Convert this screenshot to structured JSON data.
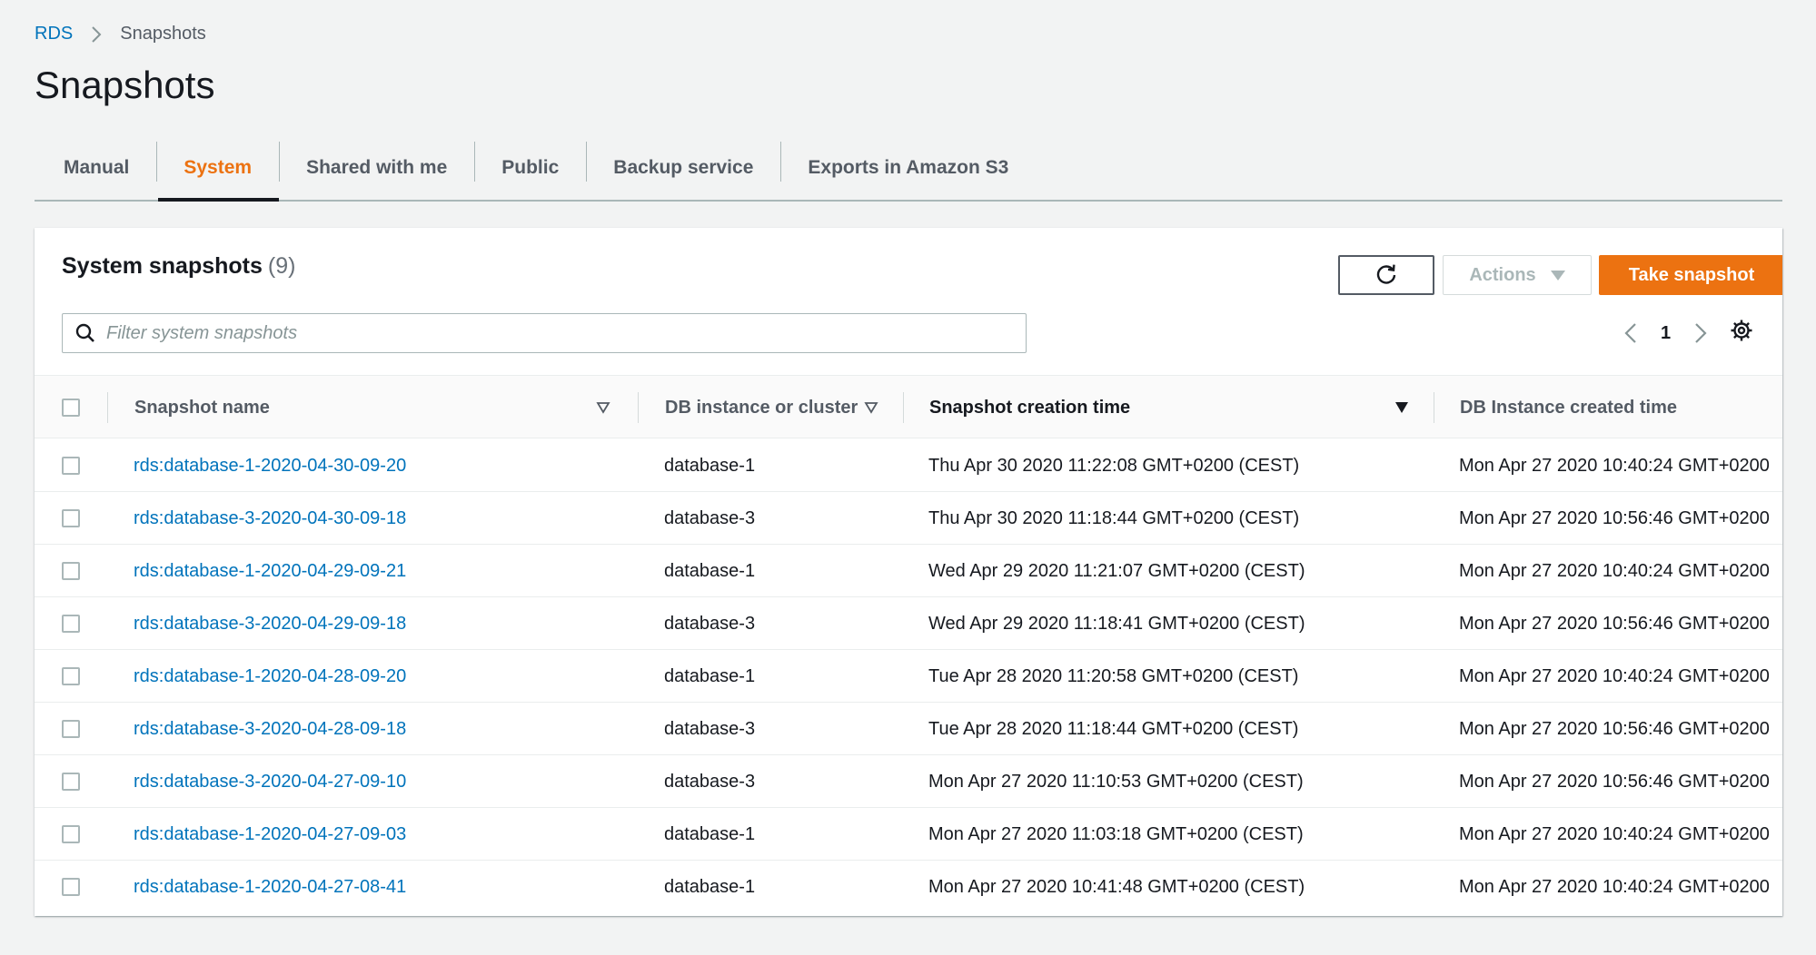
{
  "breadcrumb": {
    "root": "RDS",
    "current": "Snapshots"
  },
  "page": {
    "title": "Snapshots"
  },
  "tabs": [
    {
      "label": "Manual",
      "active": false
    },
    {
      "label": "System",
      "active": true
    },
    {
      "label": "Shared with me",
      "active": false
    },
    {
      "label": "Public",
      "active": false
    },
    {
      "label": "Backup service",
      "active": false
    },
    {
      "label": "Exports in Amazon S3",
      "active": false
    }
  ],
  "panel": {
    "title": "System snapshots",
    "count": "(9)",
    "actions_label": "Actions",
    "primary_label": "Take snapshot",
    "search_placeholder": "Filter system snapshots",
    "search_value": "",
    "current_page": "1"
  },
  "table": {
    "columns": {
      "name": "Snapshot name",
      "db": "DB instance or cluster",
      "created": "Snapshot creation time",
      "instance_created": "DB Instance created time"
    },
    "rows": [
      {
        "name": "rds:database-1-2020-04-30-09-20",
        "db": "database-1",
        "created": "Thu Apr 30 2020 11:22:08 GMT+0200 (CEST)",
        "instance_created": "Mon Apr 27 2020 10:40:24 GMT+0200"
      },
      {
        "name": "rds:database-3-2020-04-30-09-18",
        "db": "database-3",
        "created": "Thu Apr 30 2020 11:18:44 GMT+0200 (CEST)",
        "instance_created": "Mon Apr 27 2020 10:56:46 GMT+0200"
      },
      {
        "name": "rds:database-1-2020-04-29-09-21",
        "db": "database-1",
        "created": "Wed Apr 29 2020 11:21:07 GMT+0200 (CEST)",
        "instance_created": "Mon Apr 27 2020 10:40:24 GMT+0200"
      },
      {
        "name": "rds:database-3-2020-04-29-09-18",
        "db": "database-3",
        "created": "Wed Apr 29 2020 11:18:41 GMT+0200 (CEST)",
        "instance_created": "Mon Apr 27 2020 10:56:46 GMT+0200"
      },
      {
        "name": "rds:database-1-2020-04-28-09-20",
        "db": "database-1",
        "created": "Tue Apr 28 2020 11:20:58 GMT+0200 (CEST)",
        "instance_created": "Mon Apr 27 2020 10:40:24 GMT+0200"
      },
      {
        "name": "rds:database-3-2020-04-28-09-18",
        "db": "database-3",
        "created": "Tue Apr 28 2020 11:18:44 GMT+0200 (CEST)",
        "instance_created": "Mon Apr 27 2020 10:56:46 GMT+0200"
      },
      {
        "name": "rds:database-3-2020-04-27-09-10",
        "db": "database-3",
        "created": "Mon Apr 27 2020 11:10:53 GMT+0200 (CEST)",
        "instance_created": "Mon Apr 27 2020 10:56:46 GMT+0200"
      },
      {
        "name": "rds:database-1-2020-04-27-09-03",
        "db": "database-1",
        "created": "Mon Apr 27 2020 11:03:18 GMT+0200 (CEST)",
        "instance_created": "Mon Apr 27 2020 10:40:24 GMT+0200"
      },
      {
        "name": "rds:database-1-2020-04-27-08-41",
        "db": "database-1",
        "created": "Mon Apr 27 2020 10:41:48 GMT+0200 (CEST)",
        "instance_created": "Mon Apr 27 2020 10:40:24 GMT+0200"
      }
    ]
  },
  "colors": {
    "accent": "#ec7211",
    "link": "#0073bb",
    "background": "#f2f3f3"
  },
  "icons": [
    "chevron-right-icon",
    "refresh-icon",
    "caret-down-icon",
    "search-icon",
    "chevron-left-icon",
    "gear-icon",
    "sort-icon",
    "sort-descending-icon"
  ]
}
